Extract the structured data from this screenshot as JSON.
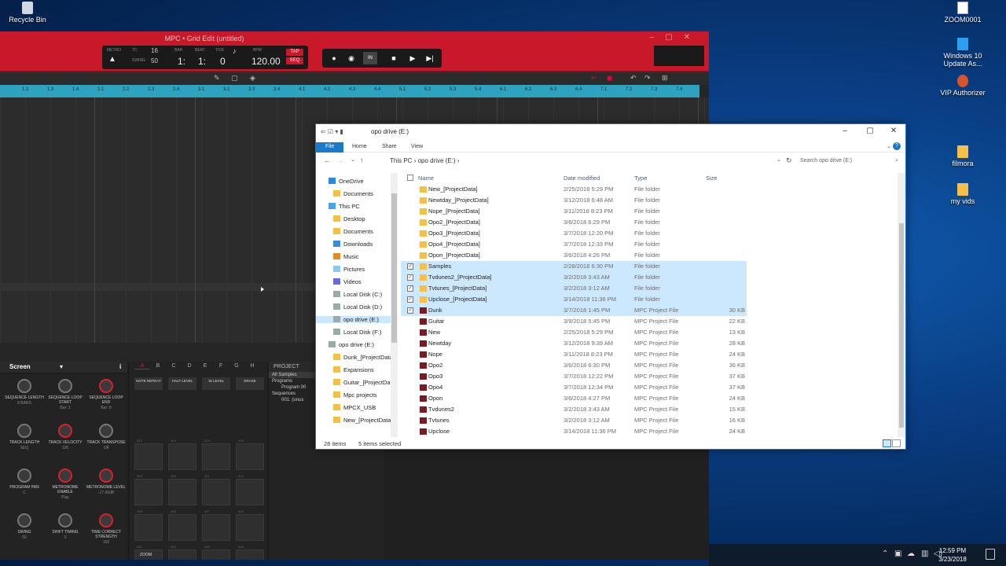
{
  "desktop": {
    "icons_left": [
      {
        "label": "Recycle Bin"
      }
    ],
    "icons_right": [
      {
        "label": "ZOOM0001"
      },
      {
        "label": "Windows 10 Update As..."
      },
      {
        "label": "VIP Authorizer"
      },
      {
        "label": "filmora"
      },
      {
        "label": "my vids"
      }
    ]
  },
  "mpc": {
    "title": "MPC • Grid Edit (untitled)",
    "counter": {
      "metro_label": "METRO",
      "tc_label": "TC",
      "tc_value": "16",
      "swing_label": "SWING",
      "swing_value": "50",
      "bar_label": "BAR",
      "beat_label": "BEAT",
      "tick_label": "TICK",
      "bar_value": "1:",
      "beat_value": "1:",
      "tick_value": "0",
      "bpm_label": "BPM",
      "bpm_value": "120.00",
      "tap_label": "TAP",
      "seq_label": "SEQ"
    },
    "ruler_ticks": [
      "1.2",
      "1.3",
      "1.4",
      "2.1",
      "2.2",
      "2.3",
      "2.4",
      "3.1",
      "3.2",
      "3.3",
      "3.4",
      "4.1",
      "4.2",
      "4.3",
      "4.4",
      "5.1",
      "5.2",
      "5.3",
      "5.4",
      "6.1",
      "6.2",
      "6.3",
      "6.4",
      "7.1",
      "7.2",
      "7.3",
      "7.4",
      "8.1",
      "8.2",
      "8.3",
      "8.4"
    ],
    "screen": {
      "label": "Screen"
    },
    "knobs": [
      {
        "label": "SEQUENCE LENGTH",
        "value": "8 BARS",
        "red": false
      },
      {
        "label": "SEQUENCE LOOP START",
        "value": "Bar: 1",
        "red": false
      },
      {
        "label": "SEQUENCE LOOP END",
        "value": "Bar: 8",
        "red": true
      },
      {
        "label": "TRACK LENGTH",
        "value": "SEQ",
        "red": false
      },
      {
        "label": "TRACK VELOCITY",
        "value": "100",
        "red": true
      },
      {
        "label": "TRACK TRANSPOSE",
        "value": "Off",
        "red": false
      },
      {
        "label": "PROGRAM PAN",
        "value": "C",
        "red": false
      },
      {
        "label": "METRONOME ENABLE",
        "value": "Play",
        "red": true
      },
      {
        "label": "METRONOME LEVEL",
        "value": "-17.66dB",
        "red": true
      },
      {
        "label": "SWING",
        "value": "50",
        "red": false
      },
      {
        "label": "SHIFT TIMING",
        "value": "0",
        "red": false
      },
      {
        "label": "TIME CORRECT STRENGTH",
        "value": "100",
        "red": true
      }
    ],
    "pad_banks": [
      "A",
      "B",
      "C",
      "D",
      "E",
      "F",
      "G",
      "H"
    ],
    "pad_buttons": [
      "NOTE REPEAT",
      "HALF LEVEL",
      "16 LEVEL",
      "ERASE"
    ],
    "pad_labels": [
      "A13",
      "A14",
      "A15",
      "A16",
      "A09",
      "A10",
      "A11",
      "A12",
      "A05",
      "A06",
      "A07",
      "A08",
      "A01",
      "A02",
      "A03",
      "A04"
    ],
    "zoom_label": "ZOOM",
    "project": {
      "header": "PROJECT",
      "items": [
        "All Samples",
        "Programs",
        "Program 00",
        "Sequences",
        "001: (unus"
      ]
    }
  },
  "explorer": {
    "title": "opo drive (E:)",
    "ribbon_tabs": [
      "File",
      "Home",
      "Share",
      "View"
    ],
    "breadcrumb": [
      "This PC",
      "opo drive (E:)"
    ],
    "search_placeholder": "Search opo drive (E:)",
    "nav": [
      {
        "label": "OneDrive",
        "icon": "cloud-icon",
        "indent": 1
      },
      {
        "label": "Documents",
        "icon": "folder-icon",
        "indent": 2
      },
      {
        "label": "This PC",
        "icon": "computer-icon",
        "indent": 1
      },
      {
        "label": "Desktop",
        "icon": "folder-icon",
        "indent": 2
      },
      {
        "label": "Documents",
        "icon": "folder-icon",
        "indent": 2
      },
      {
        "label": "Downloads",
        "icon": "download-icon",
        "indent": 2
      },
      {
        "label": "Music",
        "icon": "music-icon",
        "indent": 2
      },
      {
        "label": "Pictures",
        "icon": "pictures-icon",
        "indent": 2
      },
      {
        "label": "Videos",
        "icon": "videos-icon",
        "indent": 2
      },
      {
        "label": "Local Disk (C:)",
        "icon": "disk-icon",
        "indent": 2
      },
      {
        "label": "Local Disk (D:)",
        "icon": "disk-icon",
        "indent": 2
      },
      {
        "label": "opo drive (E:)",
        "icon": "disk-icon",
        "indent": 2,
        "selected": true
      },
      {
        "label": "Local Disk (F:)",
        "icon": "disk-icon",
        "indent": 2
      },
      {
        "label": "opo drive (E:)",
        "icon": "disk-icon",
        "indent": 1
      },
      {
        "label": "Dunk_[ProjectData]",
        "icon": "folder-icon",
        "indent": 2
      },
      {
        "label": "Expansions",
        "icon": "folder-icon",
        "indent": 2
      },
      {
        "label": "Guitar_[ProjectData]",
        "icon": "folder-icon",
        "indent": 2
      },
      {
        "label": "Mpc projects",
        "icon": "folder-icon",
        "indent": 2
      },
      {
        "label": "MPCX_USB",
        "icon": "folder-icon",
        "indent": 2
      },
      {
        "label": "New_[ProjectData]",
        "icon": "folder-icon",
        "indent": 2
      }
    ],
    "columns": {
      "name": "Name",
      "date": "Date modified",
      "type": "Type",
      "size": "Size"
    },
    "rows": [
      {
        "name": "New_[ProjectData]",
        "date": "2/25/2018 5:29 PM",
        "type": "File folder",
        "size": "",
        "kind": "folder",
        "selected": false
      },
      {
        "name": "Newtday_[ProjectData]",
        "date": "3/12/2018 6:48 AM",
        "type": "File folder",
        "size": "",
        "kind": "folder",
        "selected": false
      },
      {
        "name": "Nope_[ProjectData]",
        "date": "3/11/2018 8:23 PM",
        "type": "File folder",
        "size": "",
        "kind": "folder",
        "selected": false
      },
      {
        "name": "Opo2_[ProjectData]",
        "date": "3/6/2018 6:29 PM",
        "type": "File folder",
        "size": "",
        "kind": "folder",
        "selected": false
      },
      {
        "name": "Opo3_[ProjectData]",
        "date": "3/7/2018 12:20 PM",
        "type": "File folder",
        "size": "",
        "kind": "folder",
        "selected": false
      },
      {
        "name": "Opo4_[ProjectData]",
        "date": "3/7/2018 12:33 PM",
        "type": "File folder",
        "size": "",
        "kind": "folder",
        "selected": false
      },
      {
        "name": "Opon_[ProjectData]",
        "date": "3/6/2018 4:26 PM",
        "type": "File folder",
        "size": "",
        "kind": "folder",
        "selected": false
      },
      {
        "name": "Samples",
        "date": "2/28/2018 6:30 PM",
        "type": "File folder",
        "size": "",
        "kind": "folder",
        "selected": true
      },
      {
        "name": "Tvdunes2_[ProjectData]",
        "date": "3/2/2018 3:43 AM",
        "type": "File folder",
        "size": "",
        "kind": "folder",
        "selected": true
      },
      {
        "name": "Tvtunes_[ProjectData]",
        "date": "3/2/2018 3:12 AM",
        "type": "File folder",
        "size": "",
        "kind": "folder",
        "selected": true
      },
      {
        "name": "Upclose_[ProjectData]",
        "date": "3/14/2018 11:36 PM",
        "type": "File folder",
        "size": "",
        "kind": "folder",
        "selected": true
      },
      {
        "name": "Dunk",
        "date": "3/7/2018 1:45 PM",
        "type": "MPC Project File",
        "size": "30 KB",
        "kind": "mpc",
        "selected": true
      },
      {
        "name": "Guitar",
        "date": "3/9/2018 5:45 PM",
        "type": "MPC Project File",
        "size": "22 KB",
        "kind": "mpc",
        "selected": false
      },
      {
        "name": "New",
        "date": "2/25/2018 5:29 PM",
        "type": "MPC Project File",
        "size": "13 KB",
        "kind": "mpc",
        "selected": false
      },
      {
        "name": "Newtday",
        "date": "3/12/2018 9:39 AM",
        "type": "MPC Project File",
        "size": "28 KB",
        "kind": "mpc",
        "selected": false
      },
      {
        "name": "Nope",
        "date": "3/11/2018 8:23 PM",
        "type": "MPC Project File",
        "size": "24 KB",
        "kind": "mpc",
        "selected": false
      },
      {
        "name": "Opo2",
        "date": "3/6/2018 6:30 PM",
        "type": "MPC Project File",
        "size": "36 KB",
        "kind": "mpc",
        "selected": false
      },
      {
        "name": "Opo3",
        "date": "3/7/2018 12:22 PM",
        "type": "MPC Project File",
        "size": "37 KB",
        "kind": "mpc",
        "selected": false
      },
      {
        "name": "Opo4",
        "date": "3/7/2018 12:34 PM",
        "type": "MPC Project File",
        "size": "37 KB",
        "kind": "mpc",
        "selected": false
      },
      {
        "name": "Opon",
        "date": "3/6/2018 4:27 PM",
        "type": "MPC Project File",
        "size": "24 KB",
        "kind": "mpc",
        "selected": false
      },
      {
        "name": "Tvdunes2",
        "date": "3/2/2018 3:43 AM",
        "type": "MPC Project File",
        "size": "15 KB",
        "kind": "mpc",
        "selected": false
      },
      {
        "name": "Tvtunes",
        "date": "3/2/2018 3:12 AM",
        "type": "MPC Project File",
        "size": "16 KB",
        "kind": "mpc",
        "selected": false
      },
      {
        "name": "Upclose",
        "date": "3/14/2018 11:36 PM",
        "type": "MPC Project File",
        "size": "24 KB",
        "kind": "mpc",
        "selected": false
      }
    ],
    "status": {
      "count": "28 items",
      "selected": "5 items selected"
    }
  },
  "taskbar": {
    "time": "12:59 PM",
    "date": "3/23/2018"
  },
  "colors": {
    "mpc_red": "#c8182a",
    "ruler": "#2da3bf",
    "selection": "#cce8ff",
    "accent": "#1979ca"
  }
}
